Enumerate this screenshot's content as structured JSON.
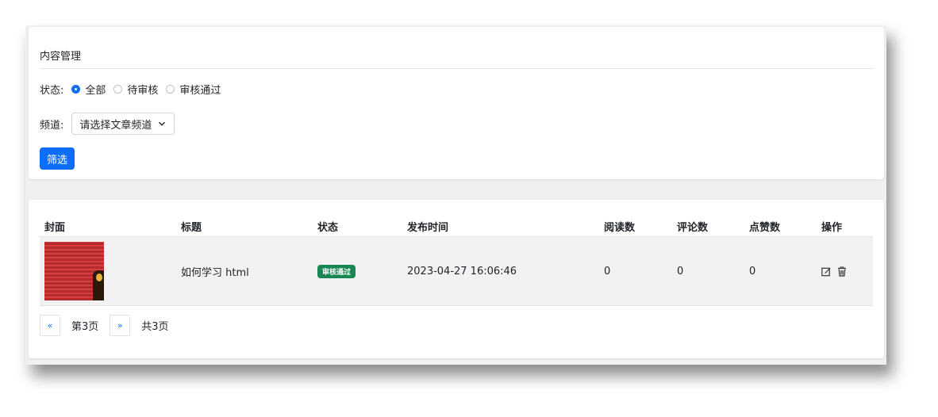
{
  "filter_panel": {
    "title": "内容管理",
    "status_label": "状态:",
    "status_options": [
      {
        "label": "全部",
        "checked": true
      },
      {
        "label": "待审核",
        "checked": false
      },
      {
        "label": "审核通过",
        "checked": false
      }
    ],
    "channel_label": "频道:",
    "channel_select_value": "请选择文章频道",
    "filter_button": "筛选"
  },
  "table": {
    "headers": [
      "封面",
      "标题",
      "状态",
      "发布时间",
      "阅读数",
      "评论数",
      "点赞数",
      "操作"
    ],
    "rows": [
      {
        "title": "如何学习 html",
        "status": "审核通过",
        "publish_time": "2023-04-27 16:06:46",
        "reads": "0",
        "comments": "0",
        "likes": "0",
        "actions": [
          "edit-icon",
          "trash-icon"
        ]
      }
    ]
  },
  "pagination": {
    "prev": "«",
    "current": "第3页",
    "next": "»",
    "total": "共3页"
  },
  "colors": {
    "primary": "#0d6efd",
    "success_badge": "#198754"
  }
}
